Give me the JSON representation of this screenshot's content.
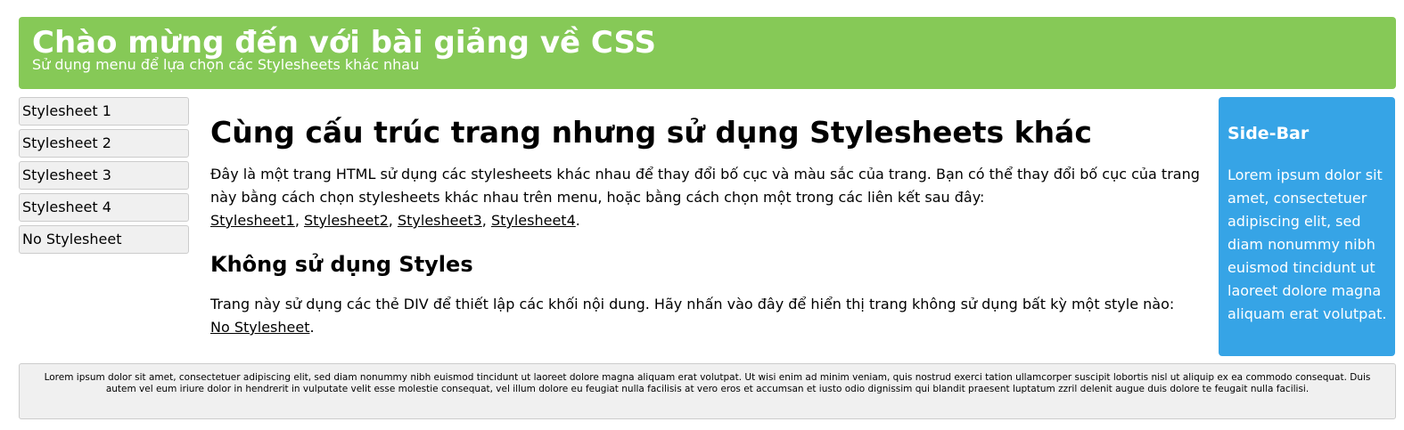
{
  "header": {
    "title": "Chào mừng đến với bài giảng về CSS",
    "subtitle": "Sử dụng menu để lựa chọn các Stylesheets khác nhau"
  },
  "menu": {
    "items": [
      {
        "label": "Stylesheet 1"
      },
      {
        "label": "Stylesheet 2"
      },
      {
        "label": "Stylesheet 3"
      },
      {
        "label": "Stylesheet 4"
      },
      {
        "label": "No Stylesheet"
      }
    ]
  },
  "main": {
    "heading": "Cùng cấu trúc trang nhưng sử dụng Stylesheets khác",
    "intro": "Đây là một trang HTML sử dụng các stylesheets khác nhau để thay đổi bố cục và màu sắc của trang. Bạn có thể thay đổi bố cục của trang này bằng cách chọn stylesheets khác nhau trên menu, hoặc bằng cách chọn một trong các liên kết sau đây:",
    "links": [
      "Stylesheet1",
      "Stylesheet2",
      "Stylesheet3",
      "Stylesheet4"
    ],
    "separator": ", ",
    "end_punct": ".",
    "subheading": "Không sử dụng Styles",
    "no_style_text": "Trang này sử dụng các thẻ DIV để thiết lập các khối nội dung. Hãy nhấn vào đây để hiển thị trang không sử dụng bất kỳ một style nào:",
    "no_style_link": "No Stylesheet"
  },
  "sidebar": {
    "title": "Side-Bar",
    "text": "Lorem ipsum dolor sit amet, consectetuer adipiscing elit, sed diam nonummy nibh euismod tincidunt ut laoreet dolore magna aliquam erat volutpat."
  },
  "footer": {
    "text": "Lorem ipsum dolor sit amet, consectetuer adipiscing elit, sed diam nonummy nibh euismod tincidunt ut laoreet dolore magna aliquam erat volutpat. Ut wisi enim ad minim veniam, quis nostrud exerci tation ullamcorper suscipit lobortis nisl ut aliquip ex ea commodo consequat. Duis autem vel eum iriure dolor in hendrerit in vulputate velit esse molestie consequat, vel illum dolore eu feugiat nulla facilisis at vero eros et accumsan et iusto odio dignissim qui blandit praesent luptatum zzril delenit augue duis dolore te feugait nulla facilisi."
  },
  "colors": {
    "header_bg": "#86c957",
    "sidebar_bg": "#36a4e6",
    "menu_bg": "#f0f0f0",
    "footer_bg": "#f0f0f0"
  }
}
